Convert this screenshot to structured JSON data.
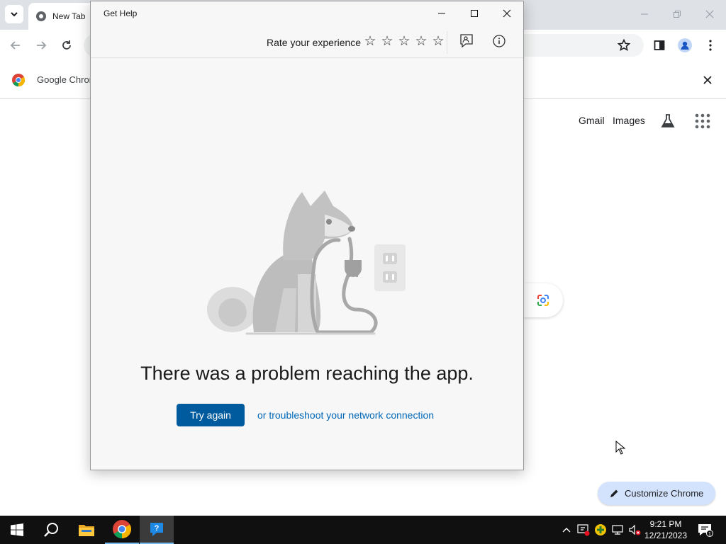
{
  "chrome": {
    "tab_title": "New Tab",
    "infobar_text": "Google Chrome",
    "ntp_links": {
      "gmail": "Gmail",
      "images": "Images"
    },
    "customize_label": "Customize Chrome"
  },
  "help_window": {
    "title": "Get Help",
    "rate_label": "Rate your experience",
    "stars": [
      "☆",
      "☆",
      "☆",
      "☆",
      "☆"
    ],
    "error_heading": "There was a problem reaching the app.",
    "try_again_label": "Try again",
    "troubleshoot_link": "or troubleshoot your network connection"
  },
  "taskbar": {
    "apps": [
      "start-icon",
      "search-icon",
      "file-explorer-icon",
      "chrome-icon",
      "get-help-icon"
    ],
    "clock_time": "9:21 PM",
    "clock_date": "12/21/2023",
    "notification_count": "1"
  },
  "colors": {
    "accent": "#005a9e",
    "link": "#0067b8",
    "customize_bg": "#d3e3fd",
    "taskbar": "#101010"
  }
}
